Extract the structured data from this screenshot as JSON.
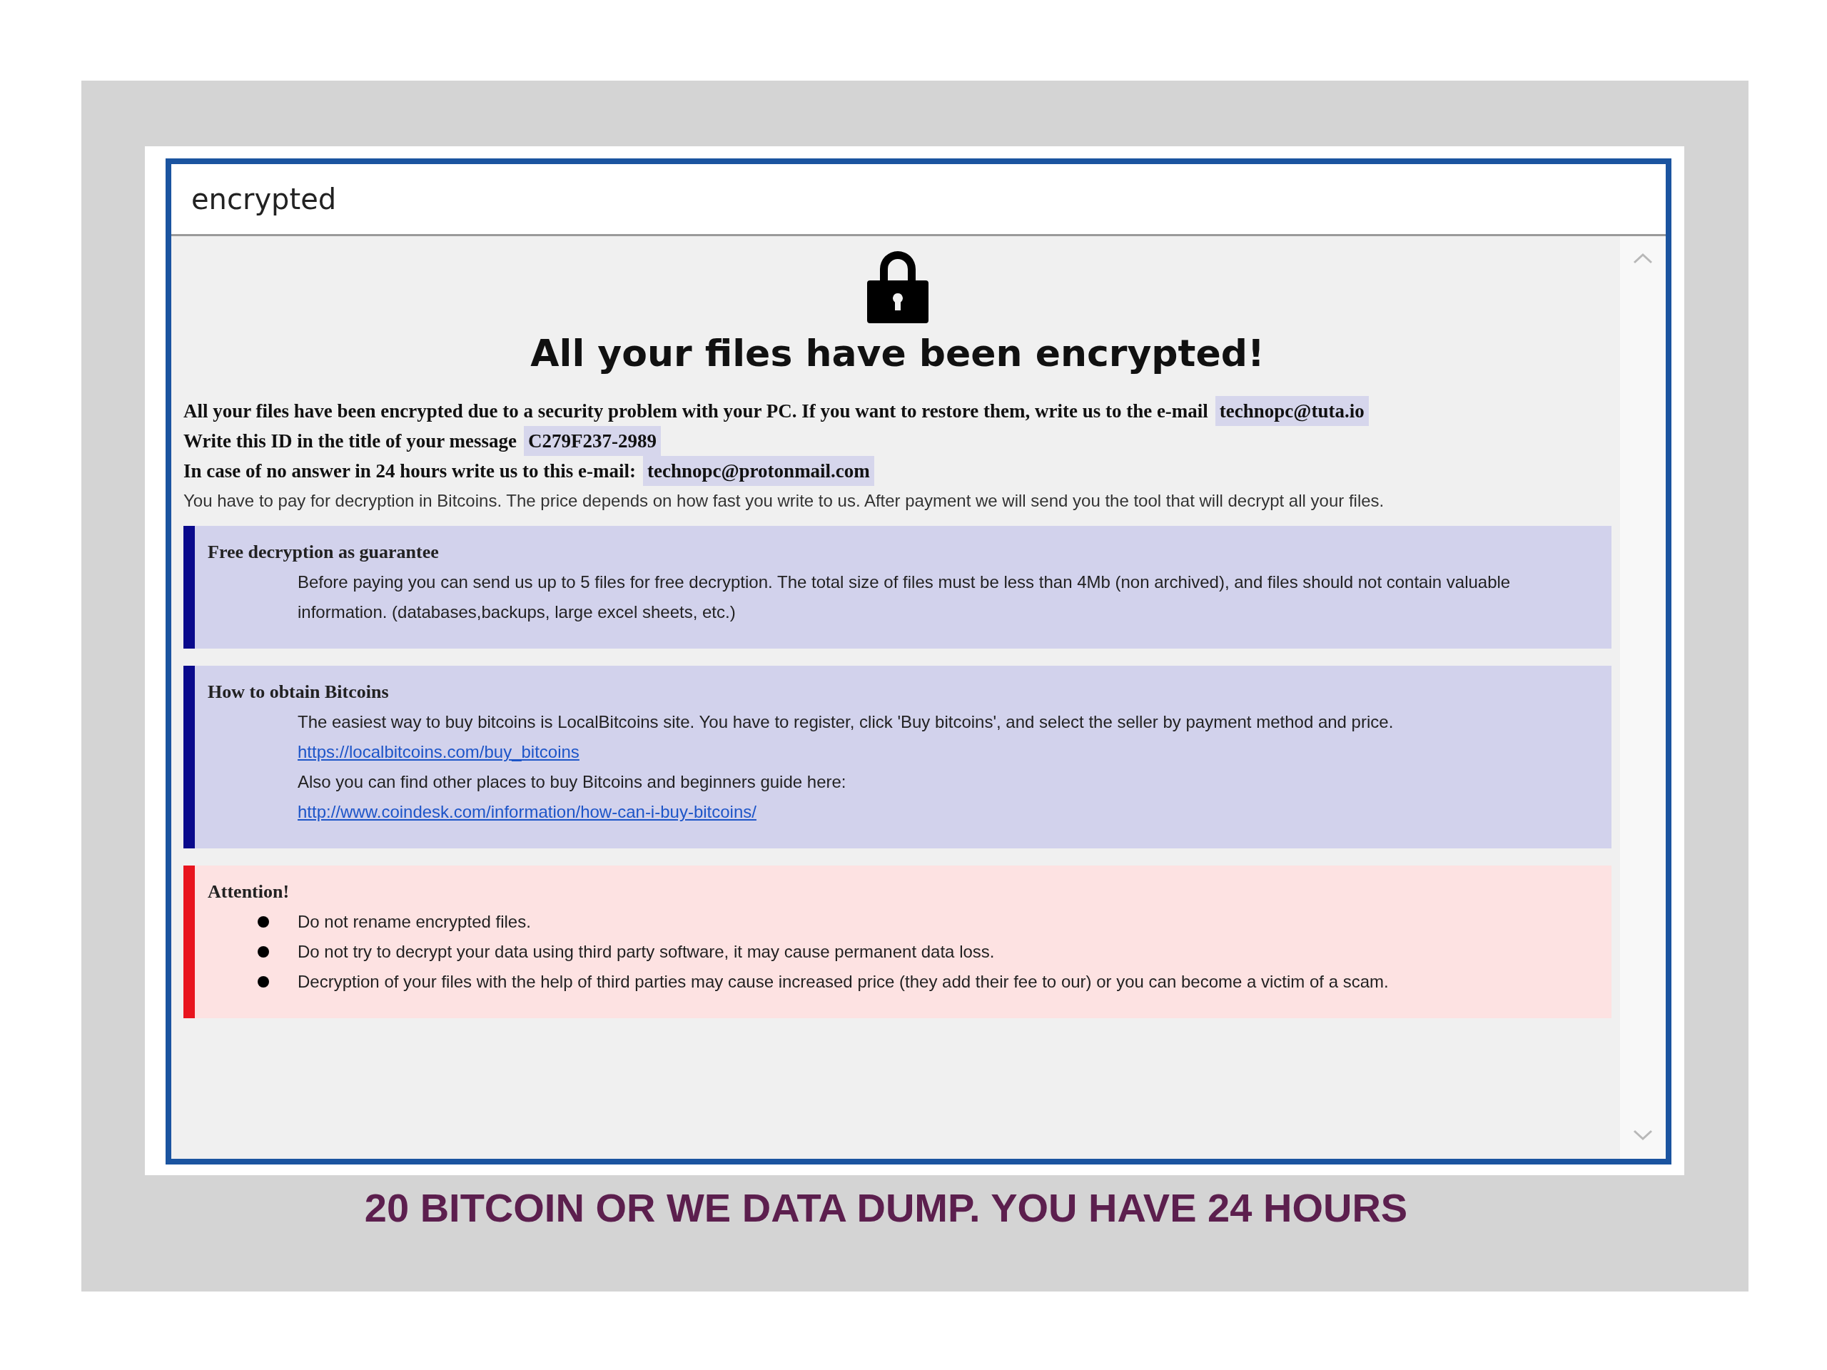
{
  "window": {
    "title": "encrypted"
  },
  "note": {
    "heading": "All your files have been encrypted!",
    "contacts": [
      {
        "label": "All your files have been encrypted due to a security problem with your PC. If you want to restore them, write us to the e-mail",
        "value": "technopc@tuta.io"
      },
      {
        "label": "Write this ID in the title of your message",
        "value": "C279F237-2989"
      },
      {
        "label": "In case of no answer in 24 hours write us to this e-mail:",
        "value": "technopc@protonmail.com"
      }
    ],
    "payment": "You have to pay for decryption in Bitcoins. The price depends on how fast you write to us. After payment we will send you the tool that will decrypt all your files.",
    "sections": [
      {
        "kind": "info",
        "title": "Free decryption as guarantee",
        "lines": [
          {
            "kind": "text",
            "text": "Before paying you can send us up to 5 files for free decryption. The total size of files must be less than 4Mb (non archived), and files should not contain valuable information. (databases,backups, large excel sheets, etc.)"
          }
        ]
      },
      {
        "kind": "info",
        "title": "How to obtain Bitcoins",
        "lines": [
          {
            "kind": "text",
            "text": "The easiest way to buy bitcoins is LocalBitcoins site. You have to register, click 'Buy bitcoins', and select the seller by payment method and price."
          },
          {
            "kind": "link",
            "text": "https://localbitcoins.com/buy_bitcoins"
          },
          {
            "kind": "text",
            "text": "Also you can find other places to buy Bitcoins and beginners guide here:"
          },
          {
            "kind": "link",
            "text": "http://www.coindesk.com/information/how-can-i-buy-bitcoins/"
          }
        ]
      },
      {
        "kind": "warning",
        "title": "Attention!",
        "lines": [
          {
            "kind": "bullet",
            "text": "Do not rename encrypted files."
          },
          {
            "kind": "bullet",
            "text": "Do not try to decrypt your data using third party software, it may cause permanent data loss."
          },
          {
            "kind": "bullet",
            "text": "Decryption of your files with the help of third parties may cause increased price (they add their fee to our) or you can become a victim of a scam."
          }
        ]
      }
    ]
  },
  "caption": "20 BITCOIN OR WE DATA DUMP. YOU HAVE 24 HOURS"
}
